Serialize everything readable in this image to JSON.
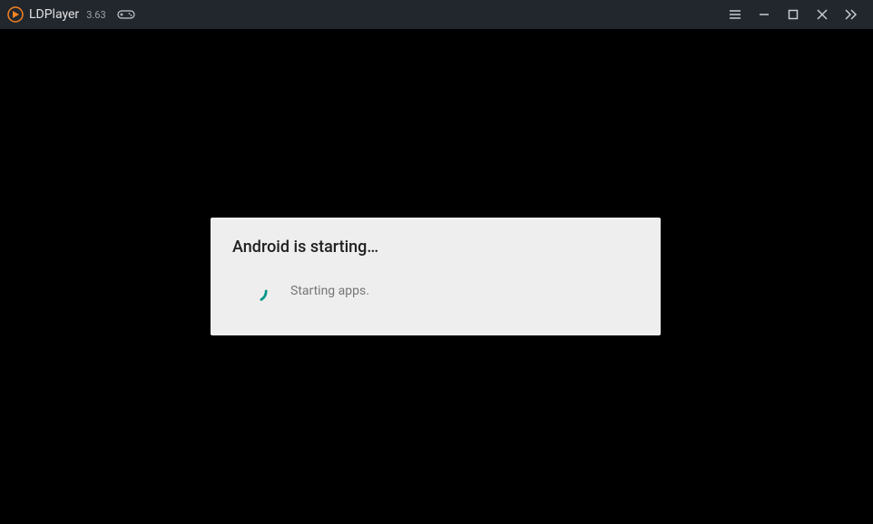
{
  "titlebar": {
    "app_name": "LDPlayer",
    "app_version": "3.63"
  },
  "dialog": {
    "title": "Android is starting…",
    "message": "Starting apps."
  },
  "colors": {
    "accent": "#f58220",
    "spinner": "#009688",
    "titlebar_bg": "#22272e"
  }
}
